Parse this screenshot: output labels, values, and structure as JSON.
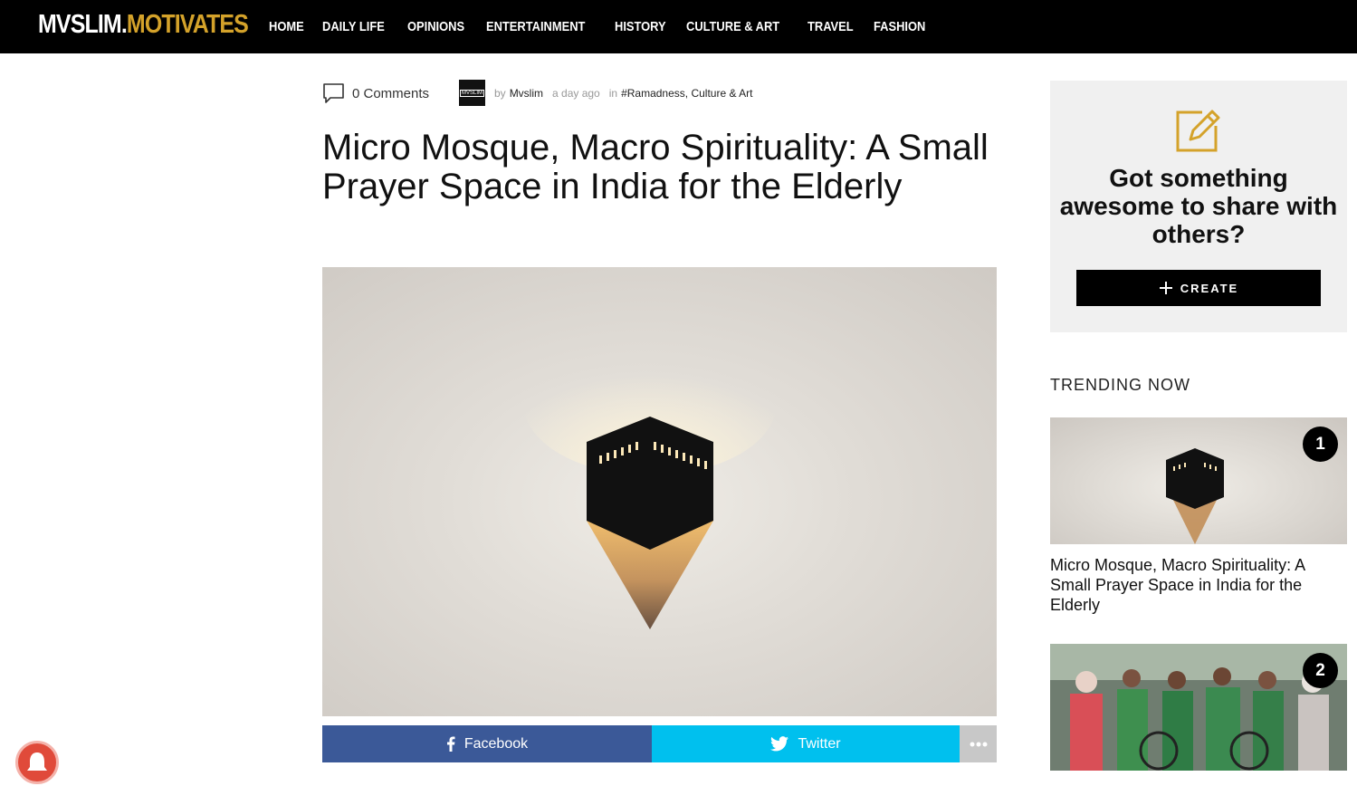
{
  "header": {
    "logo_part1": "MVSLIM.",
    "logo_part2": "MOTIVATES",
    "nav": [
      "HOME",
      "DAILY LIFE",
      "OPINIONS",
      "ENTERTAINMENT",
      "HISTORY",
      "CULTURE & ART",
      "TRAVEL",
      "FASHION"
    ]
  },
  "meta": {
    "comments": "0 Comments",
    "avatar_text": "MVSLIM",
    "by": "by",
    "author": "Mvslim",
    "time": "a day ago",
    "in": "in",
    "categories": "#Ramadness, Culture & Art"
  },
  "article": {
    "title": "Micro Mosque, Macro Spirituality: A Small Prayer Space in India for the Elderly"
  },
  "share": {
    "facebook": "Facebook",
    "twitter": "Twitter"
  },
  "sidebar": {
    "create_question": "Got something awesome to share with others?",
    "create_label": "CREATE",
    "trending_heading": "TRENDING NOW",
    "trending": [
      {
        "rank": "1",
        "title": "Micro Mosque, Macro Spirituality: A Small Prayer Space in India for the Elderly"
      },
      {
        "rank": "2",
        "title": ""
      }
    ]
  },
  "colors": {
    "brand_gold": "#d4a22a",
    "facebook": "#3b5998",
    "twitter": "#00c0ee",
    "notification": "#e04a3a"
  }
}
